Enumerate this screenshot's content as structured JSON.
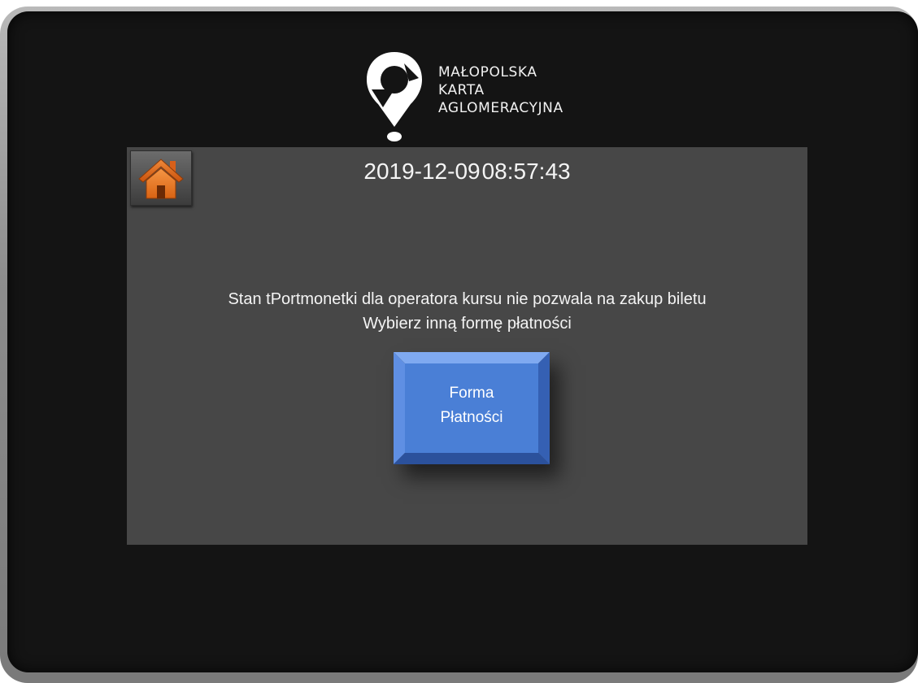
{
  "brand": {
    "logo_icon": "map-pin-icon",
    "line1": "MAŁOPOLSKA",
    "line2": "KARTA",
    "line3": "AGLOMERACYJNA"
  },
  "header": {
    "home_icon": "home-icon",
    "date": "2019-12-09",
    "time": "08:57:43"
  },
  "message": {
    "line1": "Stan tPortmonetki  dla operatora kursu nie pozwala na zakup biletu",
    "line2": "Wybierz inną formę płatności"
  },
  "payment_button": {
    "line1": "Forma",
    "line2": "Płatności"
  },
  "colors": {
    "panel": "#474747",
    "screen": "#141414",
    "button_blue": "#4a7fd6",
    "home_orange": "#e8711e"
  }
}
